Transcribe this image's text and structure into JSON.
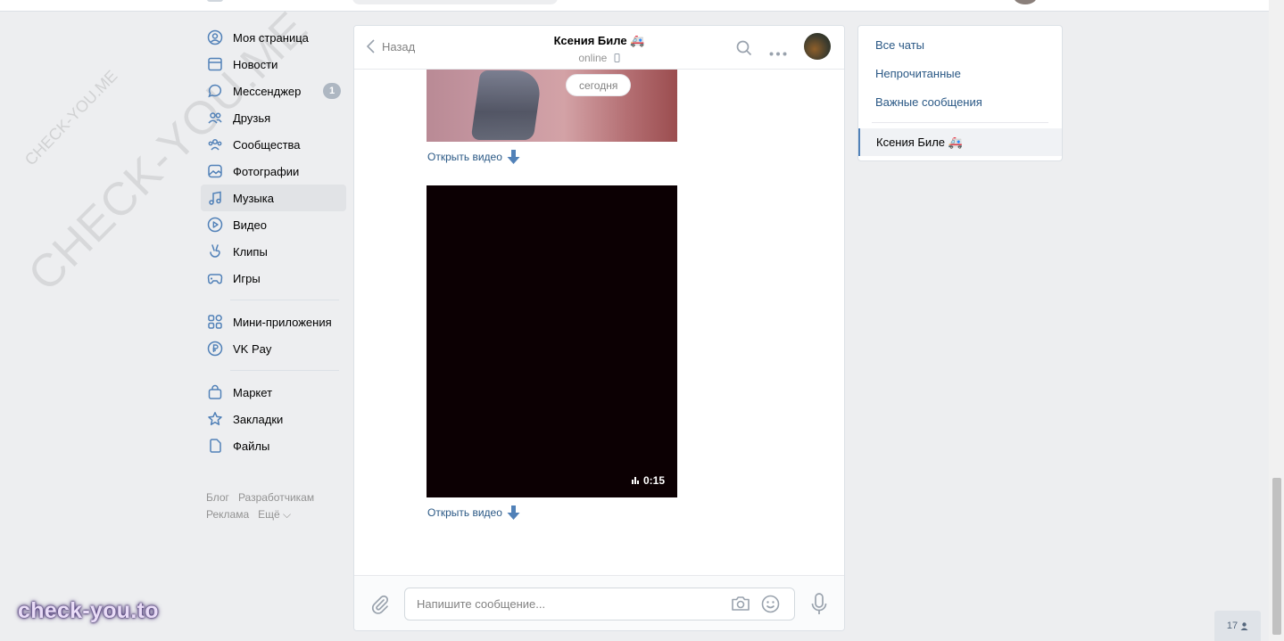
{
  "left_nav": {
    "items": [
      {
        "label": "Моя страница",
        "icon": "user-circle-icon"
      },
      {
        "label": "Новости",
        "icon": "newspaper-icon"
      },
      {
        "label": "Мессенджер",
        "icon": "chat-bubble-icon",
        "badge": "1"
      },
      {
        "label": "Друзья",
        "icon": "friends-icon"
      },
      {
        "label": "Сообщества",
        "icon": "communities-icon"
      },
      {
        "label": "Фотографии",
        "icon": "photo-icon"
      },
      {
        "label": "Музыка",
        "icon": "music-note-icon",
        "active": true
      },
      {
        "label": "Видео",
        "icon": "play-circle-icon"
      },
      {
        "label": "Клипы",
        "icon": "clips-icon"
      },
      {
        "label": "Игры",
        "icon": "gamepad-icon"
      }
    ],
    "items2": [
      {
        "label": "Мини-приложения",
        "icon": "grid-icon"
      },
      {
        "label": "VK Pay",
        "icon": "ruble-circle-icon"
      }
    ],
    "items3": [
      {
        "label": "Маркет",
        "icon": "bag-icon"
      },
      {
        "label": "Закладки",
        "icon": "star-icon"
      },
      {
        "label": "Файлы",
        "icon": "file-icon"
      }
    ],
    "footer": {
      "blog": "Блог",
      "developers": "Разработчикам",
      "ads": "Реклама",
      "more": "Ещё ⌵"
    }
  },
  "chat": {
    "back_label": "Назад",
    "peer_name": "Ксения Биле 🚑",
    "peer_status": "online",
    "date_label": "сегодня",
    "open_video_label": "Открыть видео",
    "video_duration": "0:15",
    "composer_placeholder": "Напишите сообщение..."
  },
  "right_panel": {
    "all_chats": "Все чаты",
    "unread": "Непрочитанные",
    "important": "Важные сообщения",
    "active_chat": "Ксения Биле 🚑"
  },
  "online_counter": "17",
  "watermarks": {
    "large": "CHECK-YOU.ME",
    "small": "CHECK-YOU.ME",
    "brand": "check-you.to"
  },
  "colors": {
    "accent": "#5181b8",
    "link": "#2a5885",
    "page_bg": "#edeef0"
  }
}
